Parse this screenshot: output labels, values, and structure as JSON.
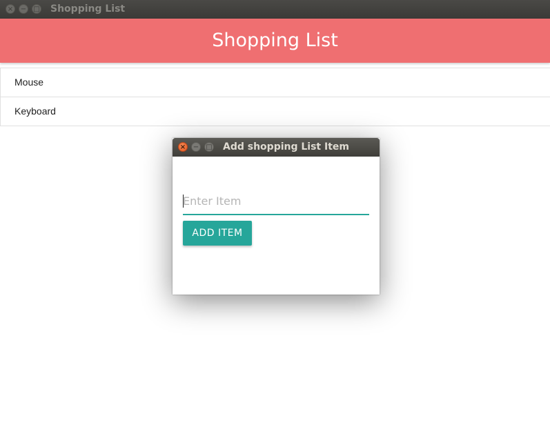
{
  "window": {
    "title": "Shopping List",
    "close_glyph": "×",
    "min_glyph": "−",
    "max_glyph": "□"
  },
  "header": {
    "title": "Shopping List",
    "color": "#ef6f71"
  },
  "list": {
    "items": [
      {
        "label": "Mouse"
      },
      {
        "label": "Keyboard"
      }
    ]
  },
  "dialog": {
    "title": "Add shopping List Item",
    "close_glyph": "×",
    "min_glyph": "−",
    "max_glyph": "□",
    "input": {
      "value": "",
      "placeholder": "Enter Item"
    },
    "add_button_label": "ADD ITEM",
    "accent": "#26a69a"
  }
}
